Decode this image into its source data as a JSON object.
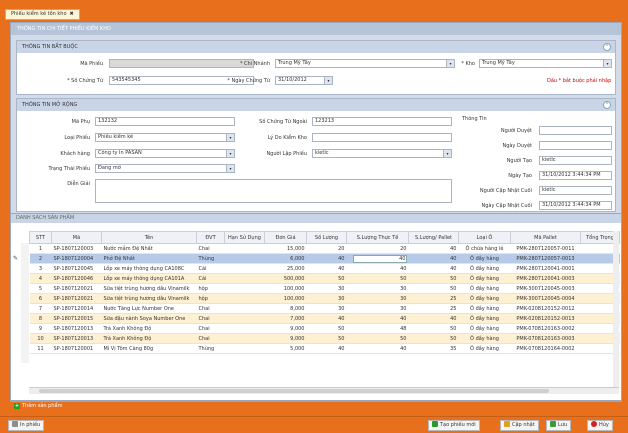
{
  "tab": {
    "title": "Phiếu kiểm kê tồn kho"
  },
  "panel_title": "THÔNG TIN CHI TIẾT PHIẾU KIỂM KHO",
  "required": {
    "title": "THÔNG TIN BẮT BUỘC",
    "ma_phieu_label": "Mã Phiếu",
    "ma_phieu_value": "",
    "chi_nhanh_label": "* Chi Nhánh",
    "chi_nhanh_value": "Trung Mỹ Tây",
    "kho_label": "* Kho",
    "kho_value": "Trung Mỹ Tây",
    "so_chung_tu_label": "* Số Chứng Từ",
    "so_chung_tu_value": "543545345",
    "ngay_chung_tu_label": "* Ngày Chứng Từ",
    "ngay_chung_tu_value": "31/10/2012",
    "note": "Dấu * bắt buộc phải nhập"
  },
  "extended": {
    "title": "THÔNG TIN MỞ RỘNG",
    "ma_phu_label": "Mã Phụ",
    "ma_phu_value": "132132",
    "so_ct_ngoai_label": "Số Chứng Từ Ngoài",
    "so_ct_ngoai_value": "123213",
    "loai_phieu_label": "Loại Phiếu",
    "loai_phieu_value": "Phiếu kiểm kê",
    "ly_do_label": "Lý Do Kiểm Kho",
    "ly_do_value": "",
    "khach_hang_label": "Khách hàng",
    "khach_hang_value": "Công ty In PASAN",
    "nguoi_lap_label": "Người Lập Phiếu",
    "nguoi_lap_value": "kietlc",
    "trang_thai_label": "Trạng Thái Phiếu",
    "trang_thai_value": "Đang mở",
    "dien_giai_label": "Diễn Giải",
    "dien_giai_value": "",
    "thong_tin_label": "Thông Tin",
    "nguoi_duyet_label": "Người Duyệt",
    "nguoi_duyet_value": "",
    "ngay_duyet_label": "Ngày Duyệt",
    "ngay_duyet_value": "",
    "nguoi_tao_label": "Người Tạo",
    "nguoi_tao_value": "kietlc",
    "ngay_tao_label": "Ngày Tạo",
    "ngay_tao_value": "31/10/2012 3:44:34 PM",
    "nguoi_cn_label": "Người Cập Nhật Cuối",
    "nguoi_cn_value": "kietlc",
    "ngay_cn_label": "Ngày Cập Nhật Cuối",
    "ngay_cn_value": "31/10/2012 3:44:34 PM"
  },
  "grid": {
    "title": "DANH SÁCH SẢN PHẨM",
    "columns": [
      "STT",
      "Mã",
      "Tên",
      "ĐVT",
      "Hạn Sử Dụng",
      "Đơn Giá",
      "Số Lượng",
      "S.Lượng Thực Tế",
      "S.Lượng/ Pallet",
      "Loại Ô",
      "Mã Pallet",
      "Tổng Trọng"
    ],
    "rows": [
      [
        "1",
        "SP-1807120003",
        "Nước mắm Đệ Nhất",
        "Chai",
        "",
        "15,000",
        "20",
        "20",
        "40",
        "Ô chứa hàng lẻ",
        "PMK-2807120057-0011",
        ""
      ],
      [
        "2",
        "SP-1807120004",
        "Phở Đệ Nhất",
        "Thùng",
        "",
        "6,000",
        "40",
        "40",
        "40",
        "Ô đầy hàng",
        "PMK-2807120057-0013",
        ""
      ],
      [
        "3",
        "SP-1807120045",
        "Lốp xe máy thông dụng CA108C",
        "Cái",
        "",
        "25,000",
        "40",
        "40",
        "40",
        "Ô đầy hàng",
        "PMK-2807120041-0001",
        ""
      ],
      [
        "4",
        "SP-1807120046",
        "Lốp xe máy thông dụng CA101A",
        "Cái",
        "",
        "500,000",
        "50",
        "50",
        "50",
        "Ô đầy hàng",
        "PMK-2807120041-0003",
        ""
      ],
      [
        "5",
        "SP-1807120021",
        "Sữa tiệt trùng hương dâu Vinamilk",
        "hộp",
        "",
        "100,000",
        "30",
        "30",
        "50",
        "Ô đầy hàng",
        "PMK-3007120045-0003",
        ""
      ],
      [
        "6",
        "SP-1807120021",
        "Sữa tiệt trùng hương dâu Vinamilk",
        "hộp",
        "",
        "100,000",
        "30",
        "30",
        "25",
        "Ô đầy hàng",
        "PMK-3007120045-0004",
        ""
      ],
      [
        "7",
        "SP-1807120014",
        "Nước Tăng Lực Number One",
        "Chai",
        "",
        "8,000",
        "30",
        "30",
        "25",
        "Ô đầy hàng",
        "PMK-0208120152-0012",
        ""
      ],
      [
        "8",
        "SP-1807120015",
        "Sữa đậu nành Soya Number One",
        "Chai",
        "",
        "7,000",
        "40",
        "40",
        "40",
        "Ô đầy hàng",
        "PMK-0208120152-0013",
        ""
      ],
      [
        "9",
        "SP-1807120013",
        "Trà Xanh Không Độ",
        "Chai",
        "",
        "9,000",
        "50",
        "48",
        "50",
        "Ô đầy hàng",
        "PMK-0708120163-0002",
        ""
      ],
      [
        "10",
        "SP-1807120013",
        "Trà Xanh Không Độ",
        "Chai",
        "",
        "9,000",
        "50",
        "50",
        "50",
        "Ô đầy hàng",
        "PMK-0708120163-0003",
        ""
      ],
      [
        "11",
        "SP-1807120001",
        "Mì Vị Tôm Càng 80g",
        "Thùng",
        "",
        "5,000",
        "40",
        "40",
        "35",
        "Ô đầy hàng",
        "PMK-0708120164-0002",
        ""
      ]
    ],
    "selected_row": 1
  },
  "add_product_label": "Thêm sản phẩm",
  "buttons": {
    "print": "In phiếu",
    "new": "Tạo phiếu mới",
    "update": "Cập nhật",
    "save": "Lưu",
    "cancel": "Hủy"
  },
  "colors": {
    "accent": "#e8701c",
    "selected_row": "#b7cbe8",
    "alt_row": "#fdf0d3",
    "required_note": "#cc0000"
  }
}
